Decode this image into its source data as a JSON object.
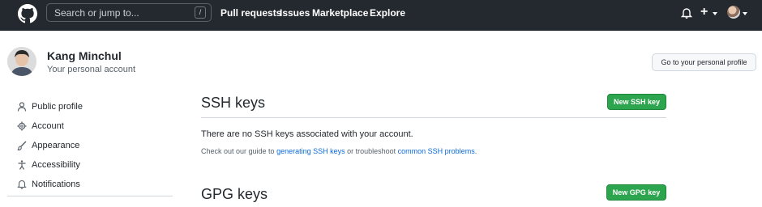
{
  "header": {
    "search_placeholder": "Search or jump to...",
    "search_shortcut": "/",
    "nav": [
      "Pull requests",
      "Issues",
      "Marketplace",
      "Explore"
    ],
    "plus_label": "+"
  },
  "profile": {
    "name": "Kang Minchul",
    "subtitle": "Your personal account",
    "go_to_profile_label": "Go to your personal profile"
  },
  "sidebar": {
    "items": [
      {
        "label": "Public profile",
        "icon": "person-icon"
      },
      {
        "label": "Account",
        "icon": "gear-icon"
      },
      {
        "label": "Appearance",
        "icon": "paintbrush-icon"
      },
      {
        "label": "Accessibility",
        "icon": "accessibility-icon"
      },
      {
        "label": "Notifications",
        "icon": "bell-icon"
      }
    ]
  },
  "ssh": {
    "title": "SSH keys",
    "new_button": "New SSH key",
    "empty_message": "There are no SSH keys associated with your account.",
    "help_prefix": "Check out our guide to ",
    "help_link1": "generating SSH keys",
    "help_middle": " or troubleshoot ",
    "help_link2": "common SSH problems",
    "help_suffix": "."
  },
  "gpg": {
    "title": "GPG keys",
    "new_button": "New GPG key"
  },
  "colors": {
    "header_bg": "#24292f",
    "primary_button": "#2da44e",
    "link": "#0969da"
  }
}
